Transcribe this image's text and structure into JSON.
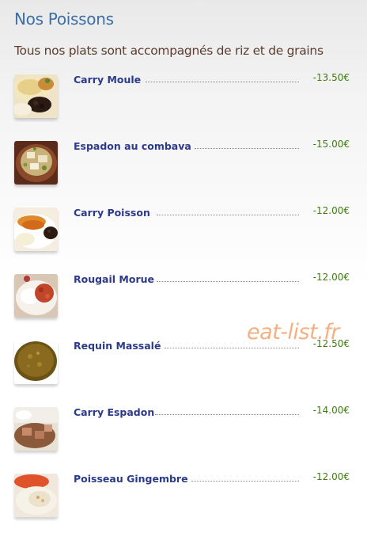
{
  "section": {
    "title": "Nos Poissons",
    "subtitle": "Tous nos plats sont accompagnés de riz et de grains"
  },
  "menu": {
    "items": [
      {
        "name": "Carry Moule",
        "price": "-13.50€",
        "icon": "carry-moule-photo"
      },
      {
        "name": "Espadon au combava",
        "price": "-15.00€",
        "icon": "espadon-combava-photo"
      },
      {
        "name": "Carry Poisson",
        "price": "-12.00€",
        "icon": "carry-poisson-photo"
      },
      {
        "name": "Rougail Morue",
        "price": "-12.00€",
        "icon": "rougail-morue-photo"
      },
      {
        "name": "Requin Massalé",
        "price": "-12.50€",
        "icon": "requin-massale-photo"
      },
      {
        "name": "Carry Espadon",
        "price": "-14.00€",
        "icon": "carry-espadon-photo"
      },
      {
        "name": "Poisseau Gingembre",
        "price": "-12.00€",
        "icon": "poisseau-gingembre-photo"
      }
    ]
  },
  "watermark": {
    "text": "eat-list.fr"
  }
}
